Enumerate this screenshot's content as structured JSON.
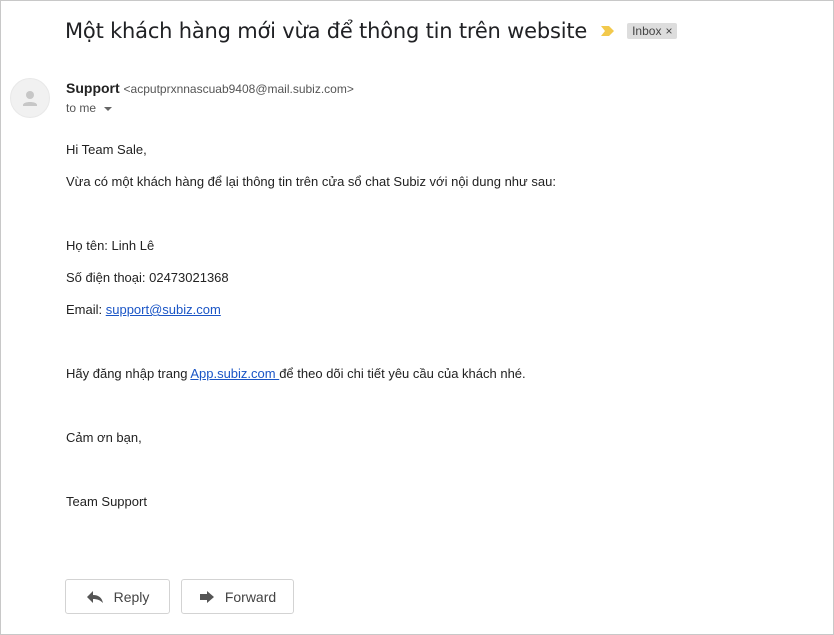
{
  "email": {
    "subject": "Một khách hàng mới vừa để thông tin trên website",
    "label": "Inbox",
    "label_remove": "×",
    "sender_name": "Support",
    "sender_email": "<acputprxnnascuab9408@mail.subiz.com>",
    "recipient": "to me",
    "body": {
      "greeting": "Hi Team Sale,",
      "intro": "Vừa có một khách hàng để lại thông tin trên cửa sổ chat Subiz với nội dung như sau:",
      "name_line": "Họ tên: Linh Lê",
      "phone_line": "Số điện thoại: 02473021368",
      "email_prefix": "Email: ",
      "email_link": "support@subiz.com",
      "login_prefix": "Hãy đăng nhập trang ",
      "login_link": "App.subiz.com ",
      "login_suffix": "để theo dõi chi tiết yêu cầu của khách nhé.",
      "thanks": "Cảm ơn bạn,",
      "signature": "Team Support"
    }
  },
  "actions": {
    "reply_label": "Reply",
    "forward_label": "Forward"
  },
  "icons": {
    "importance": "importance-marker-icon",
    "avatar": "person-icon",
    "reply": "reply-arrow-icon",
    "forward": "forward-arrow-icon",
    "recipient_details": "chevron-down-icon"
  },
  "colors": {
    "link": "#1a55c6",
    "importance": "#f2c94c",
    "label_chip": "#dddddd"
  }
}
